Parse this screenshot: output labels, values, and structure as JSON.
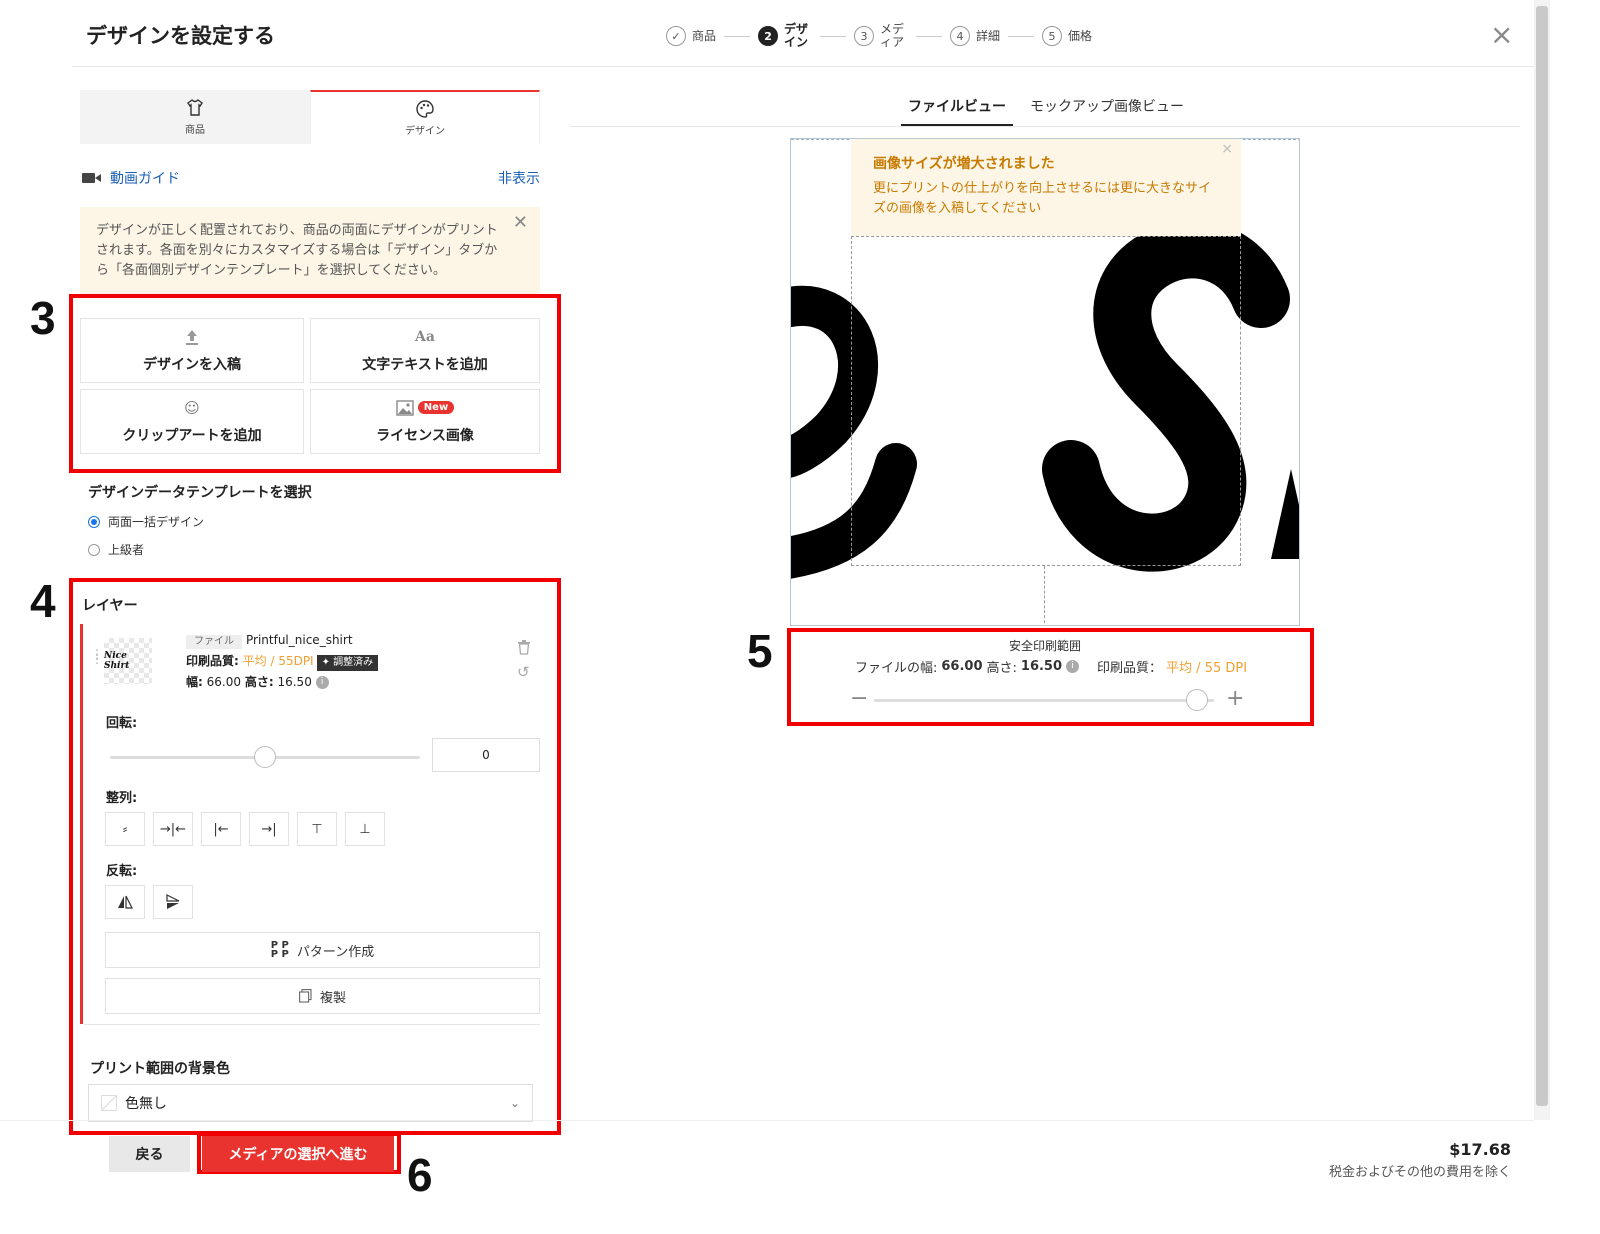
{
  "header": {
    "title": "デザインを設定する",
    "steps": [
      {
        "num": "✓",
        "label": "商品"
      },
      {
        "num": "2",
        "label": "デザイン"
      },
      {
        "num": "3",
        "label": "メディア"
      },
      {
        "num": "4",
        "label": "詳細"
      },
      {
        "num": "5",
        "label": "価格"
      }
    ],
    "close_icon": "×"
  },
  "left_tabs": [
    {
      "label": "商品",
      "icon": "tshirt-icon"
    },
    {
      "label": "デザイン",
      "icon": "palette-icon"
    }
  ],
  "video_guide": {
    "label": "動画ガイド",
    "hide_label": "非表示"
  },
  "notice": {
    "text": "デザインが正しく配置されており、商品の両面にデザインがプリントされます。各面を別々にカスタマイズする場合は「デザイン」タブから「各面個別デザインテンプレート」を選択してください。"
  },
  "actions": {
    "upload_label": "デザインを入稿",
    "add_text_label": "文字テキストを追加",
    "clipart_label": "クリップアートを追加",
    "license_label": "ライセンス画像",
    "new_badge": "New"
  },
  "template": {
    "heading": "デザインデータテンプレートを選択",
    "options": [
      {
        "label": "両面一括デザイン",
        "checked": true
      },
      {
        "label": "上級者",
        "checked": false
      }
    ]
  },
  "layers": {
    "heading": "レイヤー",
    "thumb_text": "Nice Shirt",
    "file_tag": "ファイル",
    "file_name": "Printful_nice_shirt",
    "quality_label": "印刷品質:",
    "quality_value": "平均 / 55DPI",
    "adjusted_label": "✦ 調整済み",
    "width_label": "幅:",
    "width_value": "66.00",
    "height_label": "高さ:",
    "height_value": "16.50",
    "rotation_label": "回転:",
    "rotation_value": "0",
    "align_label": "整列:",
    "flip_label": "反転:",
    "pattern_label": "パターン作成",
    "duplicate_label": "複製"
  },
  "background": {
    "heading": "プリント範囲の背景色",
    "selected": "色無し"
  },
  "footer": {
    "back_label": "戻る",
    "next_label": "メディアの選択へ進む",
    "price": "$17.68",
    "price_note": "税金およびその他の費用を除く"
  },
  "view_tabs": [
    {
      "label": "ファイルビュー",
      "active": true
    },
    {
      "label": "モックアップ画像ビュー",
      "active": false
    }
  ],
  "warning": {
    "title": "画像サイズが増大されました",
    "body": "更にプリントの仕上がりを向上させるには更に大きなサイズの画像を入稿してください"
  },
  "print_info": {
    "safe_area_label": "安全印刷範囲",
    "file_width_label": "ファイルの幅:",
    "file_width": "66.00",
    "file_height_label": "高さ:",
    "file_height": "16.50",
    "quality_label": "印刷品質：",
    "quality_value": "平均 / 55 DPI",
    "zoom_level": 0.95
  },
  "annotations": [
    "3",
    "4",
    "5",
    "6"
  ],
  "colors": {
    "accent_red": "#e8332f",
    "highlight_red": "#f00000",
    "warning_orange": "#c77a00",
    "quality_yellow": "#f0a030",
    "link_blue": "#1a5fb4"
  }
}
